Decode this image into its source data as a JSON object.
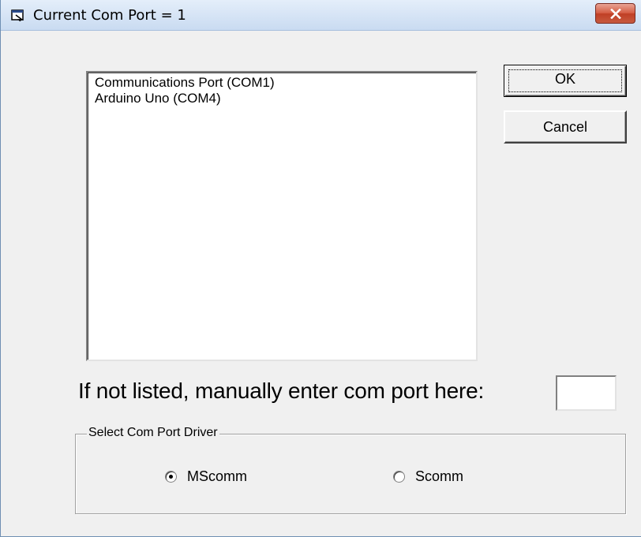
{
  "window": {
    "title": "Current Com Port = 1",
    "icon": "form-window-icon",
    "close_icon": "close-x-icon"
  },
  "port_list": {
    "items": [
      "Communications Port (COM1)",
      "Arduino Uno (COM4)"
    ]
  },
  "buttons": {
    "ok_label": "OK",
    "cancel_label": "Cancel"
  },
  "manual_entry": {
    "label": "If not listed, manually enter com port here:",
    "value": ""
  },
  "driver_group": {
    "legend": "Select Com Port Driver",
    "options": [
      {
        "label": "MScomm",
        "selected": true
      },
      {
        "label": "Scomm",
        "selected": false
      }
    ]
  },
  "colors": {
    "titlebar": "#c9dbf1",
    "dialog_background": "#f0f0f0",
    "close_button": "#c75a3f"
  }
}
